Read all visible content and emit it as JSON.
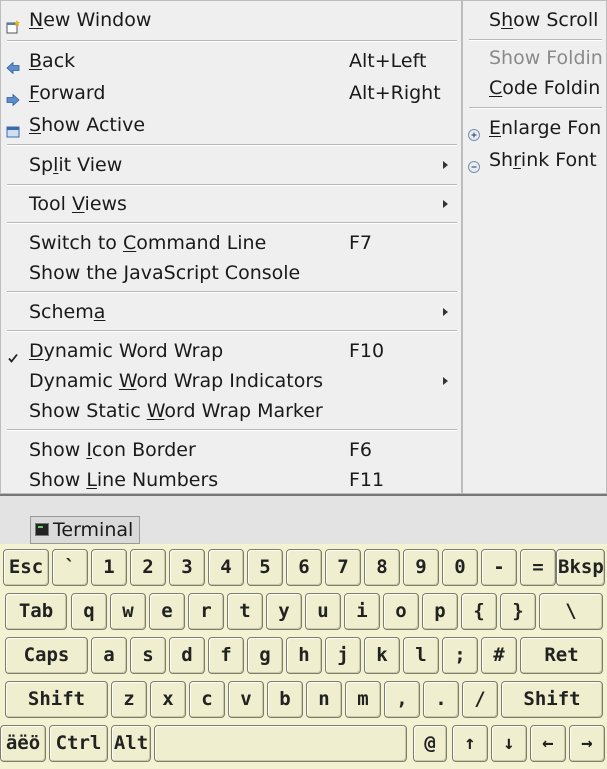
{
  "main_menu": {
    "items": [
      {
        "label": "New Window",
        "underline_index": 0,
        "shortcut": "",
        "icon": "new-window-icon",
        "submenu": false
      },
      {
        "label": "Back",
        "underline_index": 0,
        "shortcut": "Alt+Left",
        "icon": "back-arrow-icon",
        "submenu": false
      },
      {
        "label": "Forward",
        "underline_index": 0,
        "shortcut": "Alt+Right",
        "icon": "forward-arrow-icon",
        "submenu": false
      },
      {
        "label": "Show Active",
        "underline_index": 0,
        "shortcut": "",
        "icon": "show-active-icon",
        "submenu": false
      },
      {
        "label": "Split View",
        "underline_index": 2,
        "shortcut": "",
        "icon": "",
        "submenu": true
      },
      {
        "label": "Tool Views",
        "underline_index": 5,
        "shortcut": "",
        "icon": "",
        "submenu": true
      },
      {
        "label": "Switch to Command Line",
        "underline_index": 10,
        "shortcut": "F7",
        "icon": "",
        "submenu": false
      },
      {
        "label": "Show the JavaScript Console",
        "underline_index": -1,
        "shortcut": "",
        "icon": "",
        "submenu": false
      },
      {
        "label": "Schema",
        "underline_index": 5,
        "shortcut": "",
        "icon": "",
        "submenu": true
      },
      {
        "label": "Dynamic Word Wrap",
        "underline_index": 0,
        "shortcut": "F10",
        "icon": "checkmark-icon",
        "submenu": false
      },
      {
        "label": "Dynamic Word Wrap Indicators",
        "underline_index": 8,
        "shortcut": "",
        "icon": "",
        "submenu": true
      },
      {
        "label": "Show Static Word Wrap Marker",
        "underline_index": 12,
        "shortcut": "",
        "icon": "",
        "submenu": false
      },
      {
        "label": "Show Icon Border",
        "underline_index": 5,
        "shortcut": "F6",
        "icon": "",
        "submenu": false
      },
      {
        "label": "Show Line Numbers",
        "underline_index": 5,
        "shortcut": "F11",
        "icon": "",
        "submenu": false
      }
    ]
  },
  "side_menu": {
    "items": [
      {
        "label": "Show Scroll",
        "underline_index": 1,
        "icon": "",
        "disabled": false
      },
      {
        "label": "Show Foldin",
        "underline_index": -1,
        "icon": "",
        "disabled": true
      },
      {
        "label": "Code Foldin",
        "underline_index": 0,
        "icon": "",
        "disabled": false
      },
      {
        "label": "Enlarge Fon",
        "underline_index": 0,
        "icon": "zoom-in-icon",
        "disabled": false
      },
      {
        "label": "Shrink Font",
        "underline_index": 2,
        "icon": "zoom-out-icon",
        "disabled": false
      }
    ]
  },
  "taskbar": {
    "task_label": "Terminal",
    "task_icon": "terminal-icon"
  },
  "keyboard": {
    "rows": [
      [
        "Esc",
        "`",
        "1",
        "2",
        "3",
        "4",
        "5",
        "6",
        "7",
        "8",
        "9",
        "0",
        "-",
        "=",
        "Bksp"
      ],
      [
        "Tab",
        "q",
        "w",
        "e",
        "r",
        "t",
        "y",
        "u",
        "i",
        "o",
        "p",
        "{",
        "}",
        "\\"
      ],
      [
        "Caps",
        "a",
        "s",
        "d",
        "f",
        "g",
        "h",
        "j",
        "k",
        "l",
        ";",
        "#",
        "Ret"
      ],
      [
        "Shift",
        "z",
        "x",
        "c",
        "v",
        "b",
        "n",
        "m",
        ",",
        ".",
        "/",
        "Shift"
      ],
      [
        "äëö",
        "Ctrl",
        "Alt",
        "",
        "@",
        "↑",
        "↓",
        "←",
        "→"
      ]
    ]
  },
  "colors": {
    "menu_bg": "#efefef",
    "keyboard_bg": "#f3f3d4",
    "key_bg": "#efefcf",
    "disabled_text": "#8a8a8a"
  }
}
